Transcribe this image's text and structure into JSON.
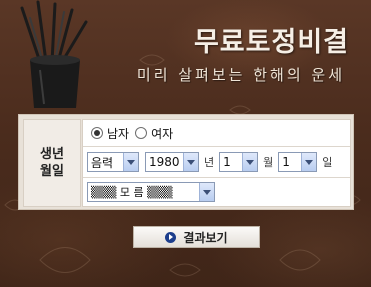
{
  "header": {
    "title": "무료토정비결",
    "subtitle": "미리 살펴보는 한해의 운세"
  },
  "form": {
    "label_line1": "생년",
    "label_line2": "월일",
    "gender": {
      "options": [
        "남자",
        "여자"
      ],
      "selected": "남자"
    },
    "calendar_select": "음력",
    "year_select": "1980",
    "year_unit": "년",
    "month_select": "1",
    "month_unit": "월",
    "day_select": "1",
    "day_unit": "일",
    "time_select": "▒▒▒ 모 름 ▒▒▒"
  },
  "actions": {
    "result_button": "결과보기"
  },
  "colors": {
    "background": "#4b2c1d",
    "button_icon": "#1d3e8c",
    "select_border": "#8a9ab5"
  }
}
